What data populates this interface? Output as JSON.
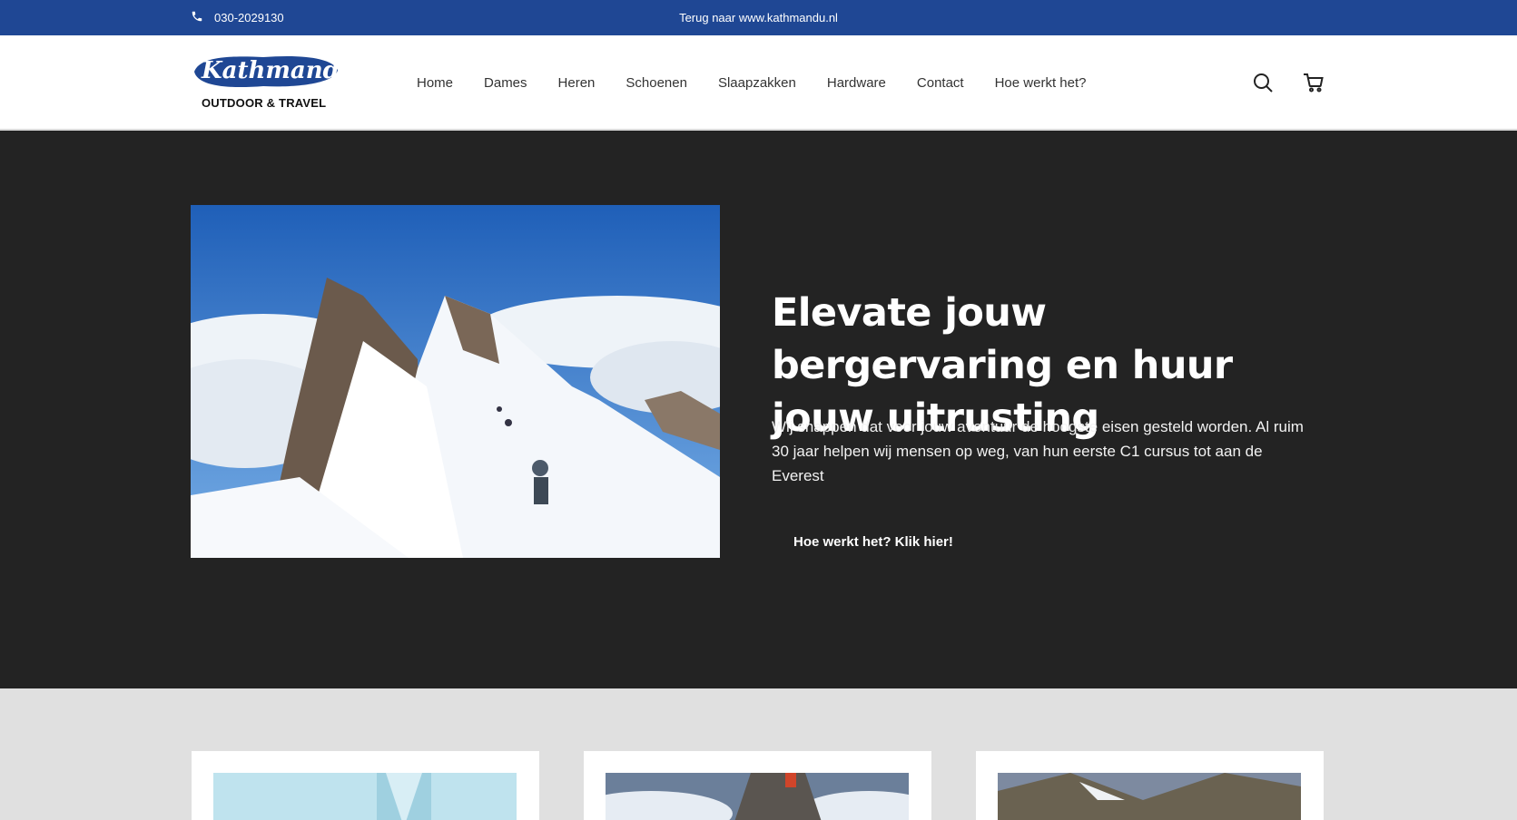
{
  "topbar": {
    "phone": "030-2029130",
    "back_link": "Terug naar www.kathmandu.nl",
    "phone_icon": "phone-icon"
  },
  "header": {
    "logo_text": "Kathmandu",
    "logo_tagline": "OUTDOOR & TRAVEL",
    "nav": [
      "Home",
      "Dames",
      "Heren",
      "Schoenen",
      "Slaapzakken",
      "Hardware",
      "Contact",
      "Hoe werkt het?"
    ],
    "icons": [
      "search-icon",
      "cart-icon"
    ]
  },
  "hero": {
    "title": "Elevate jouw bergervaring en huur jouw uitrusting",
    "text": "Wij snappen dat voor jouw avontuur de hoogste eisen gesteld worden. Al ruim 30 jaar helpen wij mensen op weg, van hun eerste C1 cursus tot aan de Everest",
    "cta": "Hoe werkt het? Klik hier!"
  },
  "colors": {
    "topbar": "#1f4794",
    "hero_bg": "#232323",
    "section_bg": "#e0e0e0"
  }
}
